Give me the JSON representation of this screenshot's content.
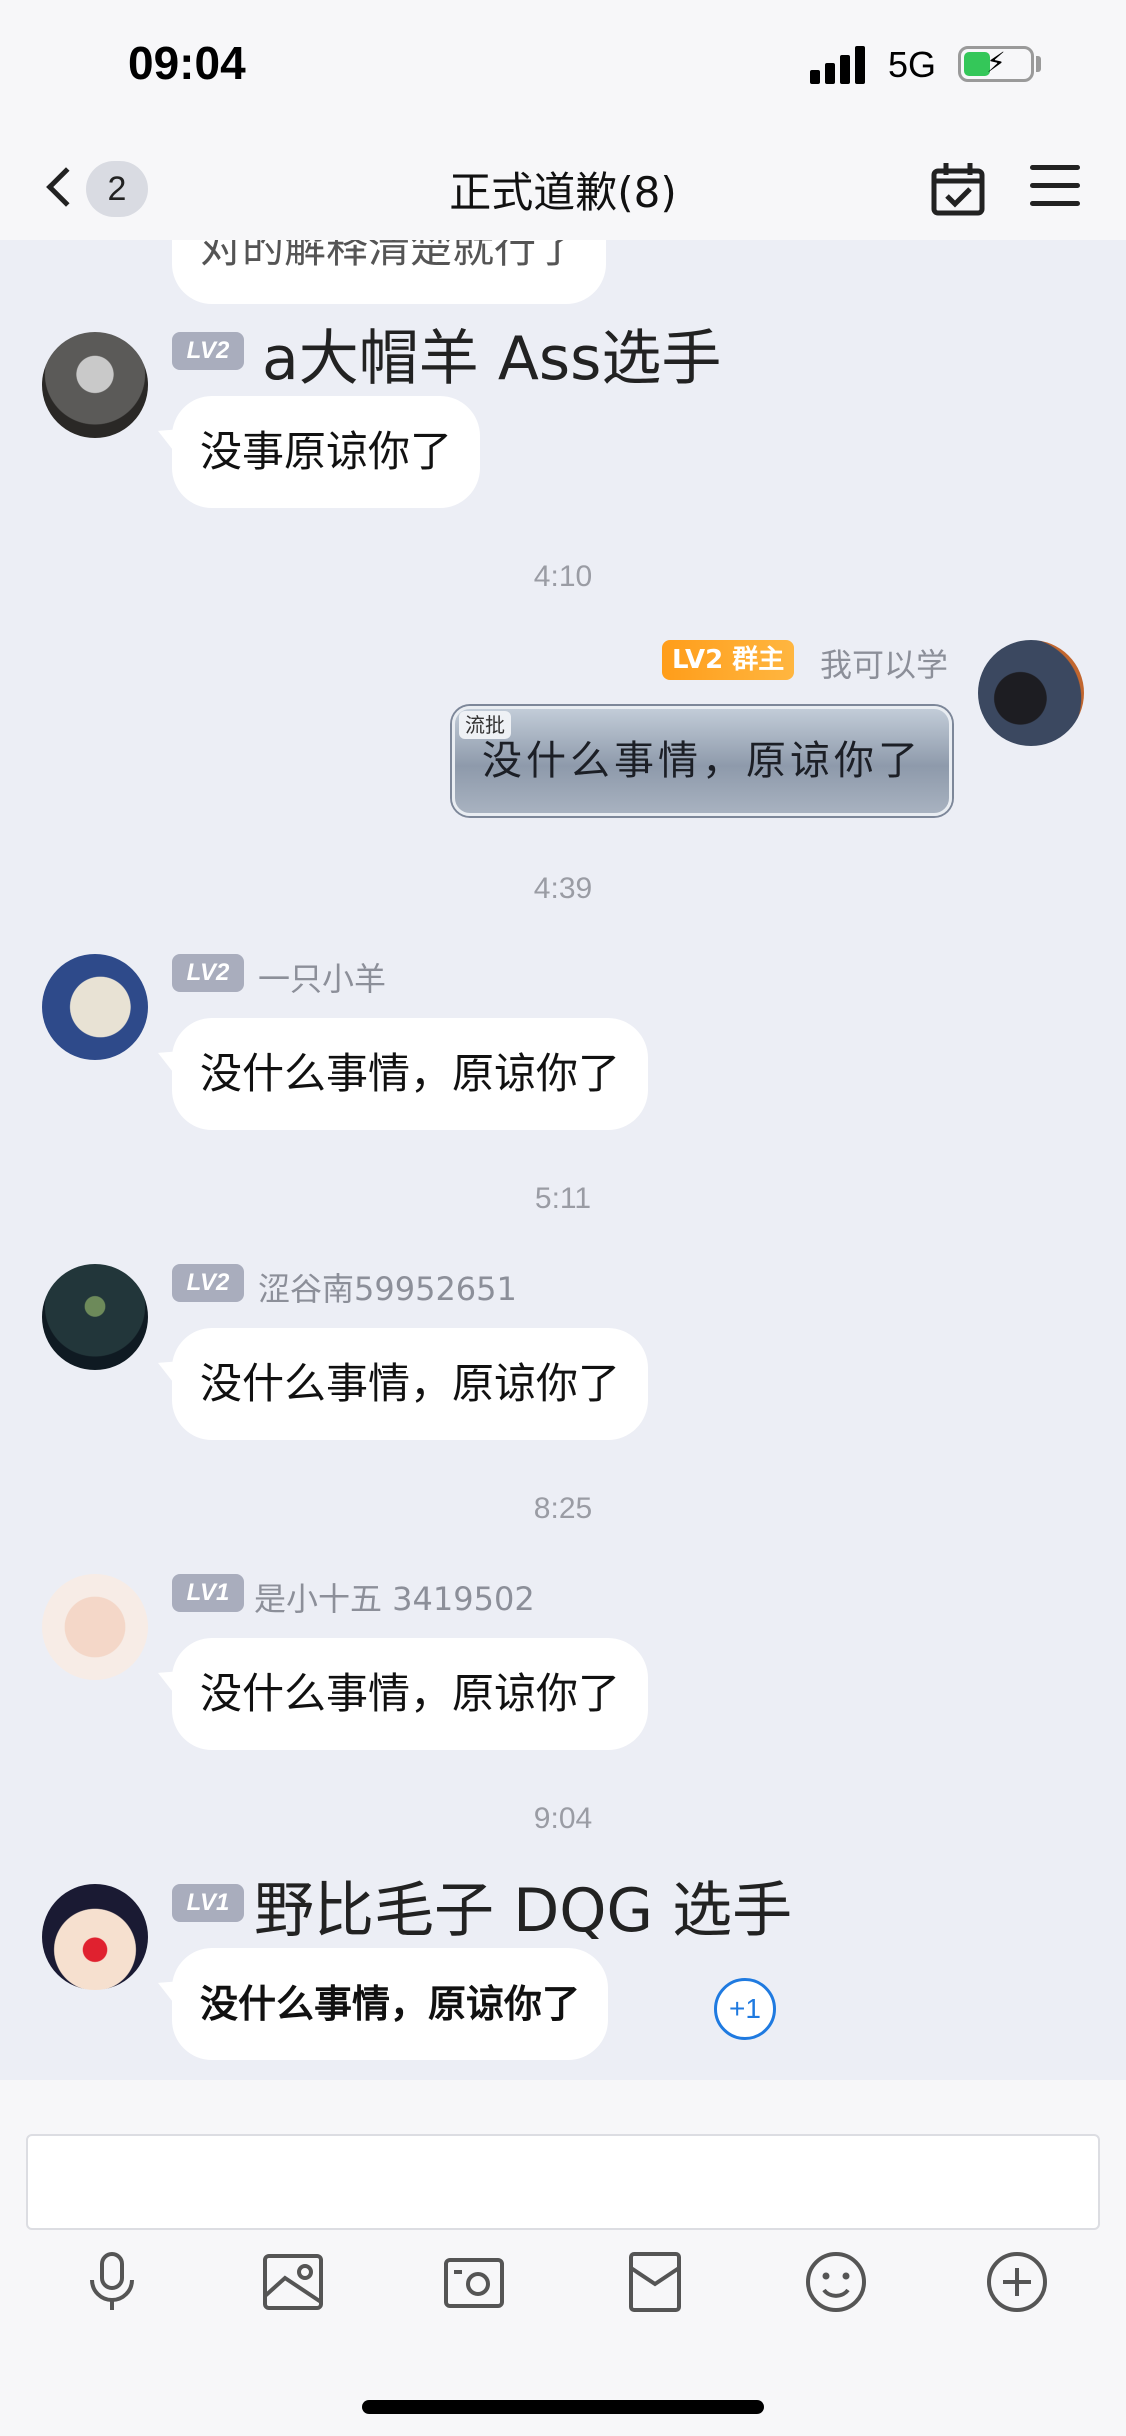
{
  "status_bar": {
    "time": "09:04",
    "network": "5G",
    "battery_level": 0.4
  },
  "nav": {
    "back_badge": "2",
    "title": "正式道歉(8)",
    "calendar_icon": "calendar-check-icon",
    "menu_icon": "hamburger-menu-icon"
  },
  "colors": {
    "background": "#eceef5",
    "bubble": "#ffffff",
    "level_badge": "#a9adbd",
    "owner_badge": "#ffa42a",
    "accent_blue": "#1f7ae0"
  },
  "messages": [
    {
      "partial_text": "对的解释清楚就行了"
    },
    {
      "level": "LV2",
      "sender": "a大帽羊 Ass选手",
      "text": "没事原谅你了"
    },
    {
      "time": "4:10"
    },
    {
      "level": "LV2",
      "role": "群主",
      "sender": "我可以学",
      "stamp_tag": "流批",
      "text": "没什么事情，原谅你了"
    },
    {
      "time": "4:39"
    },
    {
      "level": "LV2",
      "sender": "一只小羊",
      "text": "没什么事情，原谅你了"
    },
    {
      "time": "5:11"
    },
    {
      "level": "LV2",
      "sender": "涩谷南59952651",
      "text": "没什么事情，原谅你了"
    },
    {
      "time": "8:25"
    },
    {
      "level": "LV1",
      "sender": "是小十五 3419502",
      "text": "没什么事情，原谅你了"
    },
    {
      "time": "9:04"
    },
    {
      "level": "LV1",
      "sender": "野比毛子 DQG 选手",
      "text": "没什么事情，原谅你了",
      "reaction": "+1"
    }
  ],
  "toolbar": {
    "icons": [
      "microphone-icon",
      "image-icon",
      "camera-icon",
      "red-packet-icon",
      "emoji-icon",
      "plus-icon"
    ]
  }
}
